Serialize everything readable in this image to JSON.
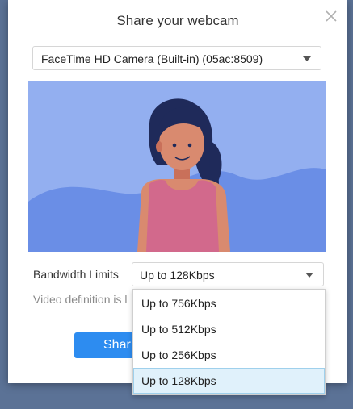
{
  "dialog": {
    "title": "Share your webcam",
    "close_icon": "close-icon"
  },
  "camera": {
    "selected": "FaceTime HD Camera (Built-in) (05ac:8509)"
  },
  "bandwidth": {
    "label": "Bandwidth Limits",
    "selected": "Up to 128Kbps",
    "options": [
      "Up to 756Kbps",
      "Up to 512Kbps",
      "Up to 256Kbps",
      "Up to 128Kbps"
    ]
  },
  "hint_text": "Video definition is l",
  "share_button": "Shar",
  "colors": {
    "accent": "#2d8cf0",
    "preview_bg": "#93aff0",
    "preview_hills": "#6a8ee6",
    "option_selected_bg": "#e0f1fb"
  }
}
